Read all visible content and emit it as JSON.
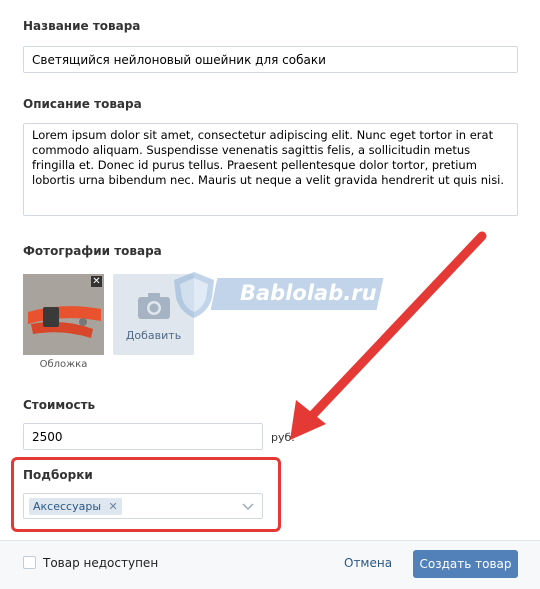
{
  "form": {
    "name_label": "Название товара",
    "name_value": "Светящийся нейлоновый ошейник для собаки",
    "description_label": "Описание товара",
    "description_value": "Lorem ipsum dolor sit amet, consectetur adipiscing elit. Nunc eget tortor in erat commodo aliquam. Suspendisse venenatis sagittis felis, a sollicitudin metus fringilla et. Donec id purus tellus. Praesent pellentesque dolor tortor, pretium lobortis urna bibendum nec. Mauris ut neque a velit gravida hendrerit ut quis nisi.",
    "photos_label": "Фотографии товара",
    "cover_caption": "Обложка",
    "add_photo_label": "Добавить",
    "price_label": "Стоимость",
    "price_value": "2500",
    "price_unit": "руб.",
    "collections_label": "Подборки",
    "collection_tag": "Аксессуары"
  },
  "footer": {
    "unavailable_label": "Товар недоступен",
    "cancel_label": "Отмена",
    "create_label": "Создать товар"
  },
  "watermark": {
    "text": "Bablolab.ru"
  },
  "colors": {
    "accent": "#5181b8",
    "highlight": "#e53935"
  }
}
